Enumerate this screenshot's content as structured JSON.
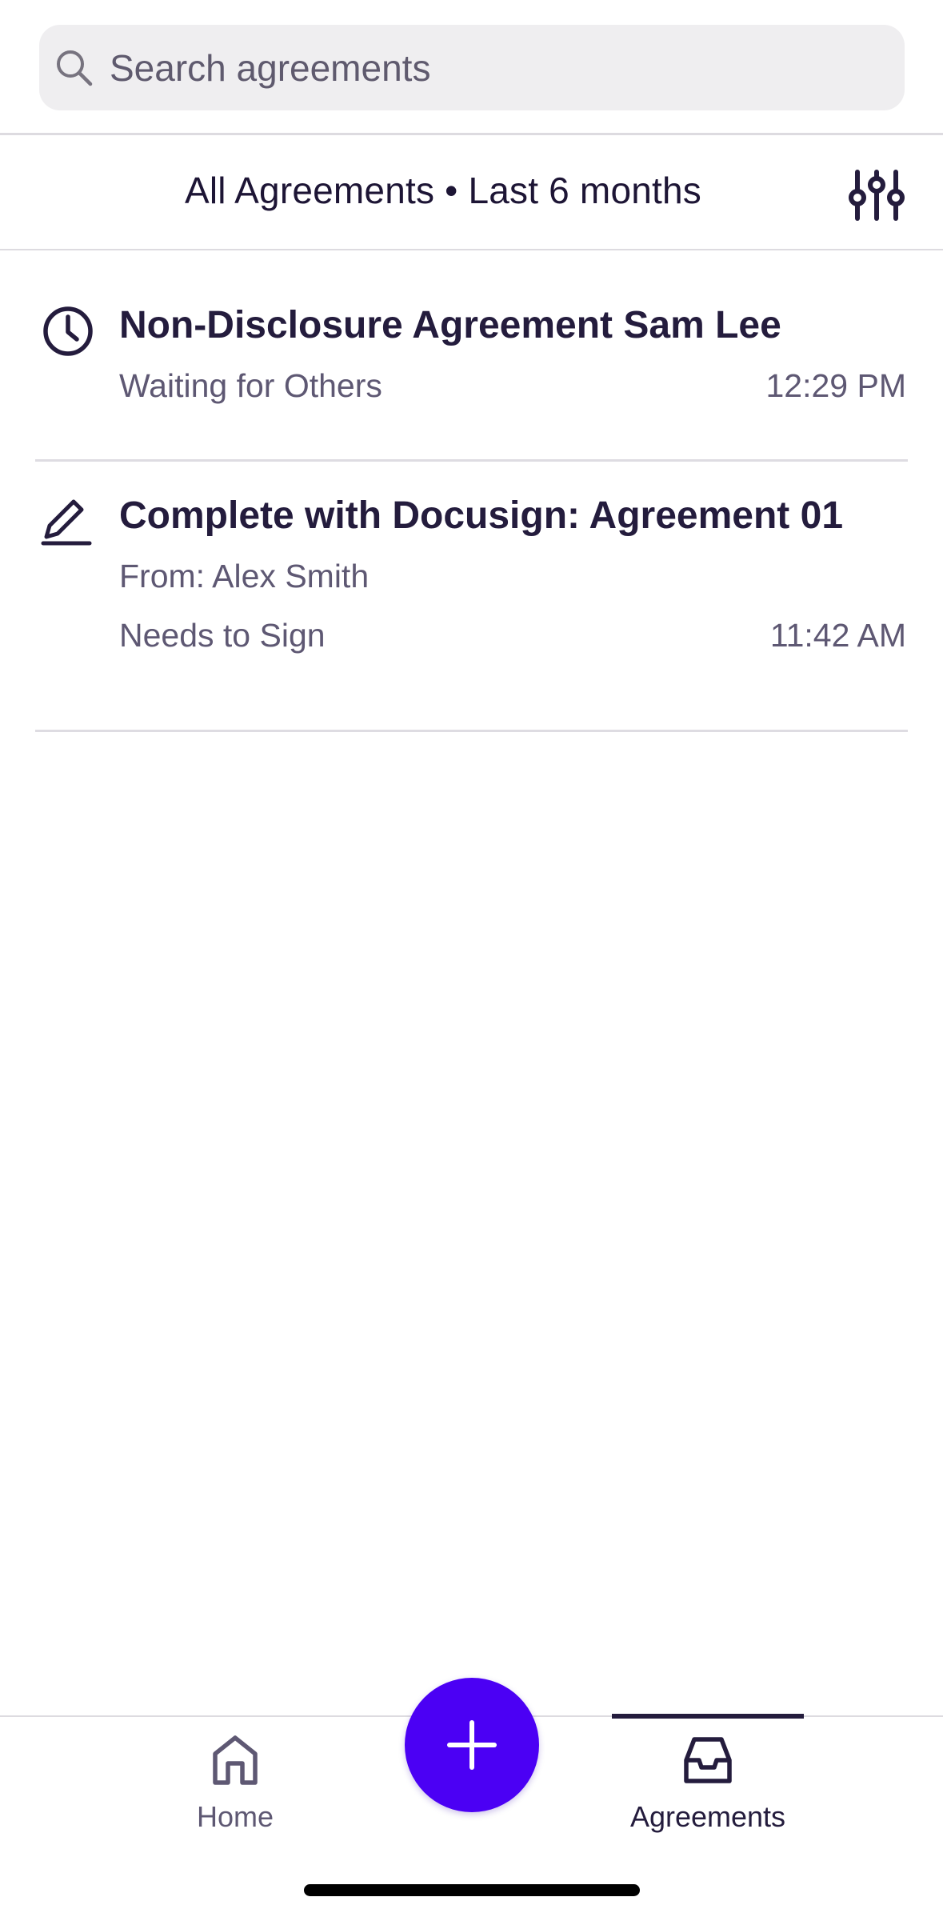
{
  "search": {
    "placeholder": "Search agreements"
  },
  "filter": {
    "title": "All Agreements • Last 6 months"
  },
  "agreements": [
    {
      "icon": "clock-icon",
      "title": "Non-Disclosure Agreement Sam Lee",
      "status": "Waiting for Others",
      "time": "12:29 PM"
    },
    {
      "icon": "pen-icon",
      "title": "Complete with Docusign: Agreement 01",
      "from": "From: Alex Smith",
      "status": "Needs to Sign",
      "time": "11:42 AM"
    }
  ],
  "nav": {
    "home_label": "Home",
    "agreements_label": "Agreements",
    "active": "Agreements"
  },
  "colors": {
    "accent": "#4b00f4",
    "text_primary": "#241c3d",
    "text_secondary": "#5e5873",
    "divider": "#dedce2"
  }
}
